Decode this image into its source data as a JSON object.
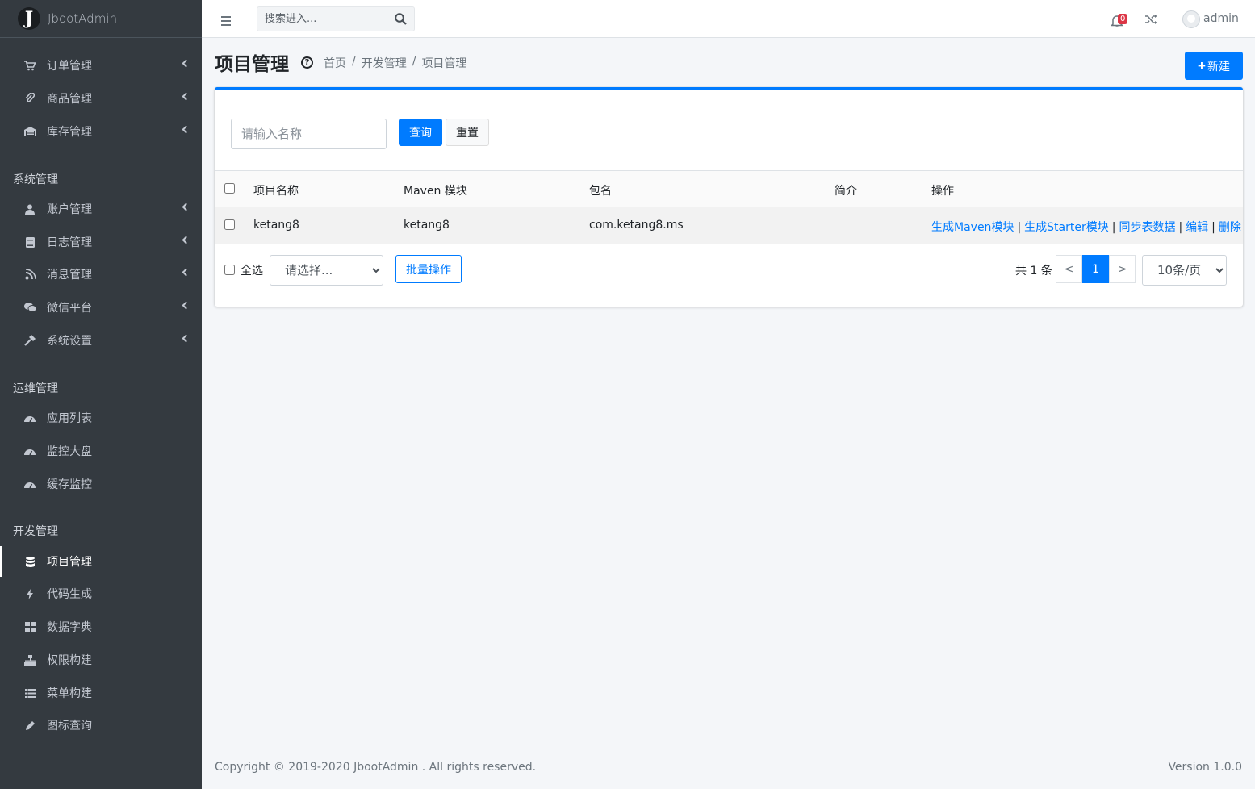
{
  "brand": {
    "logo_letter": "J",
    "name": "JbootAdmin"
  },
  "sidebar": {
    "items": [
      {
        "label": "订单管理",
        "icon": "cart-icon"
      },
      {
        "label": "商品管理",
        "icon": "paperclip-icon"
      },
      {
        "label": "库存管理",
        "icon": "warehouse-icon"
      }
    ],
    "sections": [
      {
        "header": "系统管理",
        "items": [
          {
            "label": "账户管理",
            "icon": "user-icon"
          },
          {
            "label": "日志管理",
            "icon": "book-icon"
          },
          {
            "label": "消息管理",
            "icon": "satellite-icon"
          },
          {
            "label": "微信平台",
            "icon": "wechat-icon"
          },
          {
            "label": "系统设置",
            "icon": "hammer-icon"
          }
        ]
      },
      {
        "header": "运维管理",
        "items": [
          {
            "label": "应用列表",
            "icon": "dashboard-icon"
          },
          {
            "label": "监控大盘",
            "icon": "dashboard-icon"
          },
          {
            "label": "缓存监控",
            "icon": "dashboard-icon"
          }
        ]
      },
      {
        "header": "开发管理",
        "items": [
          {
            "label": "项目管理",
            "icon": "database-icon"
          },
          {
            "label": "代码生成",
            "icon": "bolt-icon"
          },
          {
            "label": "数据字典",
            "icon": "grid-icon"
          },
          {
            "label": "权限构建",
            "icon": "sitemap-icon"
          },
          {
            "label": "菜单构建",
            "icon": "list-icon"
          },
          {
            "label": "图标查询",
            "icon": "pen-icon"
          }
        ]
      }
    ],
    "active": "项目管理"
  },
  "topbar": {
    "search_placeholder": "搜索进入...",
    "notification_count": "0",
    "user_name": "admin"
  },
  "page": {
    "title": "项目管理",
    "breadcrumb": [
      "首页",
      "开发管理",
      "项目管理"
    ],
    "new_button": "新建"
  },
  "filter": {
    "name_placeholder": "请输入名称",
    "query_button": "查询",
    "reset_button": "重置"
  },
  "table": {
    "columns": [
      "项目名称",
      "Maven 模块",
      "包名",
      "简介",
      "操作"
    ],
    "rows": [
      {
        "name": "ketang8",
        "maven_module": "ketang8",
        "package": "com.ketang8.ms",
        "intro": "",
        "actions": [
          "生成Maven模块",
          "生成Starter模块",
          "同步表数据",
          "编辑",
          "删除"
        ]
      }
    ]
  },
  "footer_bar": {
    "select_all": "全选",
    "batch_select_value": "请选择...",
    "batch_button": "批量操作",
    "total_text": "共 1 条",
    "prev": "<",
    "current_page": "1",
    "next": ">",
    "page_size": "10条/页"
  },
  "footer": {
    "copyright": "Copyright © 2019-2020 JbootAdmin . All rights reserved.",
    "version": "Version 1.0.0"
  },
  "colors": {
    "primary": "#007bff",
    "sidebar": "#343a40",
    "danger": "#dc3545"
  }
}
